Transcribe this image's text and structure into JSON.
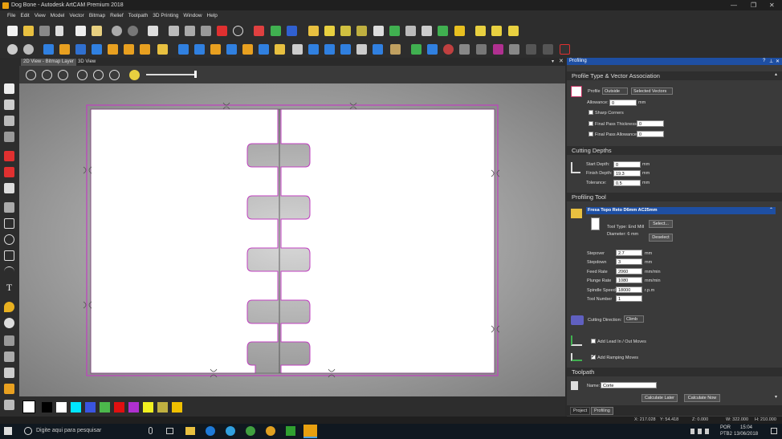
{
  "window": {
    "title": "Dog Bone - Autodesk ArtCAM Premium 2018",
    "controls": [
      "—",
      "❐",
      "✕"
    ]
  },
  "menu": [
    "File",
    "Edit",
    "View",
    "Model",
    "Vector",
    "Bitmap",
    "Relief",
    "Toolpath",
    "3D Printing",
    "Window",
    "Help"
  ],
  "tabs": {
    "active": "2D View - Bitmap Layer",
    "other": "3D View"
  },
  "panel": {
    "header": "Profiling",
    "sec_profile": "Profile Type & Vector Association",
    "profile_label": "Profile",
    "profile_type": "Outside",
    "profile_vectors": "Selected Vectors",
    "allowance_label": "Allowance:",
    "allowance_value": "0",
    "allowance_unit": "mm",
    "sharp_corners": "Sharp Corners",
    "fp_thickness_label": "Final Pass Thickness",
    "fp_thickness_value": "0",
    "fp_allowance_label": "Final Pass Allowance",
    "fp_allowance_value": "0",
    "sec_depths": "Cutting Depths",
    "start_depth_label": "Start Depth:",
    "start_depth_value": "0",
    "finish_depth_label": "Finish Depth:",
    "finish_depth_value": "19.3",
    "tolerance_label": "Tolerance:",
    "tolerance_value": "0.5",
    "unit_mm": "mm",
    "sec_tool": "Profiling Tool",
    "tool_name": "Fresa Topo Reto D6mm AC25mm",
    "tool_type": "Tool Type: End Mill",
    "tool_diameter": "Diameter:  6 mm",
    "select_btn": "Select...",
    "deselect_btn": "Deselect",
    "stepover_label": "Stepover",
    "stepover_value": "2.7",
    "stepdown_label": "Stepdown",
    "stepdown_value": "3",
    "feed_label": "Feed Rate",
    "feed_value": "2060",
    "plunge_label": "Plunge Rate",
    "plunge_value": "1080",
    "spindle_label": "Spindle Speed",
    "spindle_value": "18000",
    "tool_number_label": "Tool Number",
    "tool_number_value": "1",
    "unit_mmmin": "mm/min",
    "unit_rpm": "r.p.m",
    "cut_dir_label": "Cutting Direction:",
    "cut_dir_value": "Climb",
    "lead_moves": "Add Lead In / Out Moves",
    "ramping_moves": "Add Ramping Moves",
    "sec_toolpath": "Toolpath",
    "name_label": "Name:",
    "name_value": "Corte",
    "calc_later": "Calculate Later",
    "calc_now": "Calculate Now",
    "tab_project": "Project",
    "tab_profiling": "Profiling"
  },
  "status": {
    "x": "X: 217.028",
    "y": "Y: 54.418",
    "z": "Z: 0.000",
    "w": "W: 322.000",
    "h": "H: 210.000"
  },
  "taskbar": {
    "search": "Digite aqui para pesquisar",
    "lang": "POR",
    "kb": "PTB2",
    "time": "15:04",
    "date": "13/06/2018"
  },
  "palette": [
    "#000000",
    "#ffffff",
    "#00e5ff",
    "#3a55e0",
    "#4cb84c",
    "#e01010",
    "#b030d0",
    "#f0f020",
    "#c0b040",
    "#f0c000"
  ]
}
